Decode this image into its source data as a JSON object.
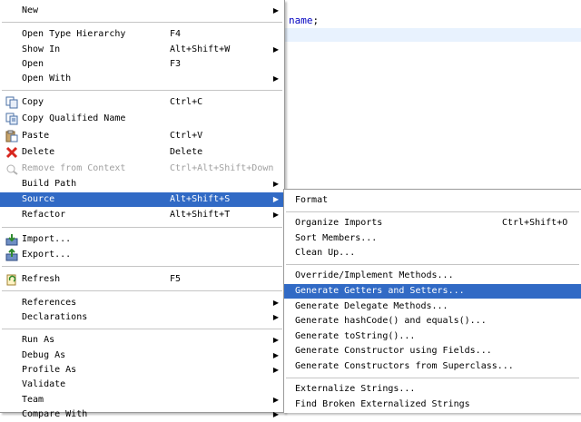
{
  "editor": {
    "code_text": "name",
    "code_semicolon": ";"
  },
  "main_menu": {
    "items": [
      {
        "label": "New",
        "shortcut": "",
        "submenu": true
      },
      {
        "label": "Open Type Hierarchy",
        "shortcut": "F4",
        "submenu": false
      },
      {
        "label": "Show In",
        "shortcut": "Alt+Shift+W",
        "submenu": true
      },
      {
        "label": "Open",
        "shortcut": "F3",
        "submenu": false
      },
      {
        "label": "Open With",
        "shortcut": "",
        "submenu": true
      },
      {
        "label": "Copy",
        "shortcut": "Ctrl+C",
        "submenu": false
      },
      {
        "label": "Copy Qualified Name",
        "shortcut": "",
        "submenu": false
      },
      {
        "label": "Paste",
        "shortcut": "Ctrl+V",
        "submenu": false
      },
      {
        "label": "Delete",
        "shortcut": "Delete",
        "submenu": false
      },
      {
        "label": "Remove from Context",
        "shortcut": "Ctrl+Alt+Shift+Down",
        "submenu": false,
        "disabled": true
      },
      {
        "label": "Build Path",
        "shortcut": "",
        "submenu": true
      },
      {
        "label": "Source",
        "shortcut": "Alt+Shift+S",
        "submenu": true,
        "selected": true
      },
      {
        "label": "Refactor",
        "shortcut": "Alt+Shift+T",
        "submenu": true
      },
      {
        "label": "Import...",
        "shortcut": "",
        "submenu": false
      },
      {
        "label": "Export...",
        "shortcut": "",
        "submenu": false
      },
      {
        "label": "Refresh",
        "shortcut": "F5",
        "submenu": false
      },
      {
        "label": "References",
        "shortcut": "",
        "submenu": true
      },
      {
        "label": "Declarations",
        "shortcut": "",
        "submenu": true
      },
      {
        "label": "Run As",
        "shortcut": "",
        "submenu": true
      },
      {
        "label": "Debug As",
        "shortcut": "",
        "submenu": true
      },
      {
        "label": "Profile As",
        "shortcut": "",
        "submenu": true
      },
      {
        "label": "Validate",
        "shortcut": "",
        "submenu": false
      },
      {
        "label": "Team",
        "shortcut": "",
        "submenu": true
      },
      {
        "label": "Compare With",
        "shortcut": "",
        "submenu": true
      }
    ]
  },
  "source_submenu": {
    "items": [
      {
        "label": "Format",
        "shortcut": ""
      },
      {
        "label": "Organize Imports",
        "shortcut": "Ctrl+Shift+O"
      },
      {
        "label": "Sort Members...",
        "shortcut": ""
      },
      {
        "label": "Clean Up...",
        "shortcut": ""
      },
      {
        "label": "Override/Implement Methods...",
        "shortcut": ""
      },
      {
        "label": "Generate Getters and Setters...",
        "shortcut": "",
        "selected": true
      },
      {
        "label": "Generate Delegate Methods...",
        "shortcut": ""
      },
      {
        "label": "Generate hashCode() and equals()...",
        "shortcut": ""
      },
      {
        "label": "Generate toString()...",
        "shortcut": ""
      },
      {
        "label": "Generate Constructor using Fields...",
        "shortcut": ""
      },
      {
        "label": "Generate Constructors from Superclass...",
        "shortcut": ""
      },
      {
        "label": "Externalize Strings...",
        "shortcut": ""
      },
      {
        "label": "Find Broken Externalized Strings",
        "shortcut": ""
      }
    ]
  },
  "icons": {
    "copy": "copy-icon",
    "copy_qualified": "copy-qualified-name-icon",
    "paste": "paste-icon",
    "delete": "delete-icon",
    "remove_context": "remove-context-icon",
    "import": "import-icon",
    "export": "export-icon",
    "refresh": "refresh-icon"
  },
  "colors": {
    "selection": "#316ac5",
    "delete_red": "#d8261e",
    "disabled": "#a0a0a0",
    "code_blue": "#0000c0"
  },
  "arrow_glyph": "▶"
}
